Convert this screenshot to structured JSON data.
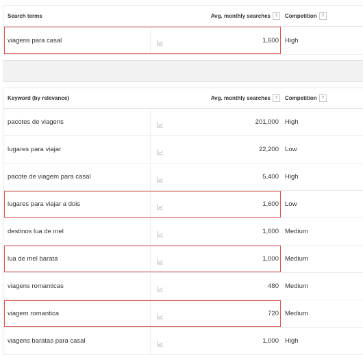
{
  "search_terms_table": {
    "headers": {
      "keyword": "Search terms",
      "avg": "Avg. monthly searches",
      "competition": "Competition",
      "help": "?"
    },
    "rows": [
      {
        "keyword": "viagens para casal",
        "avg": "1,600",
        "competition": "High",
        "highlighted": true
      }
    ]
  },
  "keyword_ideas_table": {
    "headers": {
      "keyword": "Keyword (by relevance)",
      "avg": "Avg. monthly searches",
      "competition": "Competition",
      "help": "?"
    },
    "rows": [
      {
        "keyword": "pacotes de viagens",
        "avg": "201,000",
        "competition": "High",
        "highlighted": false
      },
      {
        "keyword": "lugares para viajar",
        "avg": "22,200",
        "competition": "Low",
        "highlighted": false
      },
      {
        "keyword": "pacote de viagem para casal",
        "avg": "5,400",
        "competition": "High",
        "highlighted": false
      },
      {
        "keyword": "lugares para viajar a dois",
        "avg": "1,600",
        "competition": "Low",
        "highlighted": true
      },
      {
        "keyword": "destinos lua de mel",
        "avg": "1,600",
        "competition": "Medium",
        "highlighted": false
      },
      {
        "keyword": "lua de mel barata",
        "avg": "1,000",
        "competition": "Medium",
        "highlighted": true
      },
      {
        "keyword": "viagens romanticas",
        "avg": "480",
        "competition": "Medium",
        "highlighted": false
      },
      {
        "keyword": "viagem romantica",
        "avg": "720",
        "competition": "Medium",
        "highlighted": true
      },
      {
        "keyword": "viagens baratas para casal",
        "avg": "1,000",
        "competition": "High",
        "highlighted": false
      }
    ]
  },
  "icons": {
    "trend": "trend-chart-icon",
    "help": "help-icon"
  },
  "colors": {
    "highlight_border": "#d9534f",
    "separator_band": "#f2f2f2"
  }
}
